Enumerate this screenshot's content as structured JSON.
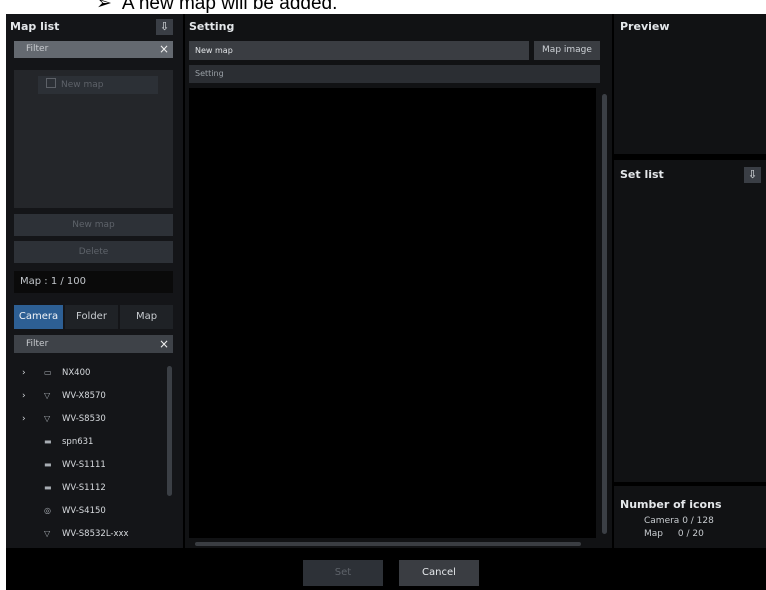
{
  "caption": {
    "arrow": "➢",
    "text": "A new map will be added."
  },
  "map_list": {
    "title": "Map list",
    "download_icon": "download-icon",
    "filter_placeholder": "Filter",
    "clear_icon": "×",
    "item": "New map",
    "new_map_button": "New map",
    "delete_button": "Delete",
    "map_counter": "Map :  1 / 100",
    "tabs": [
      {
        "label": "Camera",
        "active": true
      },
      {
        "label": "Folder",
        "active": false
      },
      {
        "label": "Map",
        "active": false
      }
    ],
    "tree_filter_placeholder": "Filter",
    "tree": [
      {
        "label": "NX400",
        "icon": "recorder-icon",
        "glyph": "▭",
        "expandable": true
      },
      {
        "label": "WV-X8570",
        "icon": "camera-icon",
        "glyph": "▽",
        "expandable": true
      },
      {
        "label": "WV-S8530",
        "icon": "camera-icon",
        "glyph": "▽",
        "expandable": true
      },
      {
        "label": "spn631",
        "icon": "box-camera-icon",
        "glyph": "▬",
        "expandable": false
      },
      {
        "label": "WV-S1111",
        "icon": "box-camera-icon",
        "glyph": "▬",
        "expandable": false
      },
      {
        "label": "WV-S1112",
        "icon": "box-camera-icon",
        "glyph": "▬",
        "expandable": false
      },
      {
        "label": "WV-S4150",
        "icon": "dome-camera-icon",
        "glyph": "◎",
        "expandable": false
      },
      {
        "label": "WV-S8532L-xxx",
        "icon": "camera-icon",
        "glyph": "▽",
        "expandable": false
      }
    ]
  },
  "setting": {
    "title": "Setting",
    "map_name_value": "New map",
    "map_image_button": "Map image",
    "setting_row": "Setting"
  },
  "preview": {
    "title": "Preview"
  },
  "set_list": {
    "title": "Set list",
    "download_icon": "download-icon"
  },
  "icons": {
    "title": "Number of icons",
    "camera_label": "Camera",
    "camera_value": "0 / 128",
    "map_label": "Map",
    "map_value": "0 / 20"
  },
  "footer": {
    "set_button": "Set",
    "cancel_button": "Cancel"
  },
  "colors": {
    "accent": "#2d5f94",
    "background": "#000000",
    "panel": "#111214"
  }
}
